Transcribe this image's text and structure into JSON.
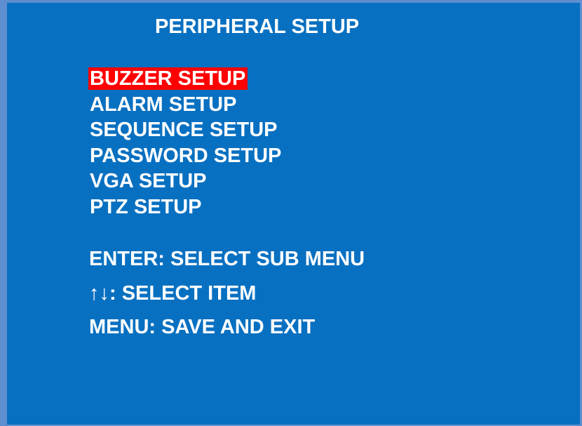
{
  "screen": {
    "title": "PERIPHERAL SETUP",
    "colors": {
      "background": "#0870c1",
      "border": "#5e8fd0",
      "text": "#ffffff",
      "selection": "#ff0000"
    }
  },
  "menu": {
    "selected_index": 0,
    "items": [
      {
        "label": "BUZZER SETUP"
      },
      {
        "label": "ALARM SETUP"
      },
      {
        "label": "SEQUENCE SETUP"
      },
      {
        "label": "PASSWORD SETUP"
      },
      {
        "label": "VGA SETUP"
      },
      {
        "label": "PTZ SETUP"
      }
    ]
  },
  "help": {
    "enter": "ENTER: SELECT SUB MENU",
    "arrows": "↑↓: SELECT ITEM",
    "menu": "MENU: SAVE AND EXIT"
  }
}
